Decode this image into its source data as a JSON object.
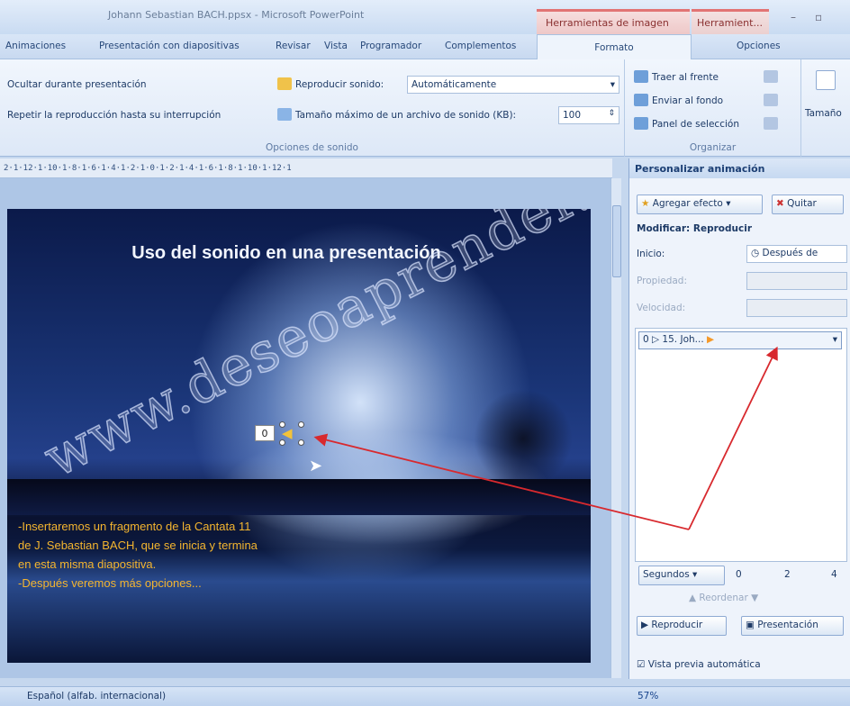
{
  "window": {
    "title": "Johann Sebastian BACH.ppsx - Microsoft PowerPoint",
    "context_tab_image_tools": "Herramientas de imagen",
    "context_tab_other": "Herramient...",
    "minimize": "–",
    "restore": "▫"
  },
  "ribbon_tabs": [
    {
      "label": "Animaciones"
    },
    {
      "label": "Presentación con diapositivas"
    },
    {
      "label": "Revisar"
    },
    {
      "label": "Vista"
    },
    {
      "label": "Programador"
    },
    {
      "label": "Complementos"
    },
    {
      "label": "Formato"
    },
    {
      "label": "Opciones"
    }
  ],
  "sound_options": {
    "hide_during_show": "Ocultar durante presentación",
    "loop_until_stopped": "Repetir la reproducción hasta su interrupción",
    "play_sound_label": "Reproducir sonido:",
    "play_sound_value": "Automáticamente",
    "max_size_label": "Tamaño máximo de un archivo de sonido (KB):",
    "max_size_value": "100",
    "group_label": "Opciones de sonido"
  },
  "arrange": {
    "bring_to_front": "Traer al frente",
    "send_to_back": "Enviar al fondo",
    "selection_pane": "Panel de selección",
    "group_label": "Organizar"
  },
  "size": {
    "label": "Tamaño"
  },
  "ruler": {
    "text": "2·1·12·1·10·1·8·1·6·1·4·1·2·1·0·1·2·1·4·1·6·1·8·1·10·1·12·1"
  },
  "slide": {
    "title": "Uso del sonido  en una presentación",
    "body_lines": [
      "-Insertaremos un fragmento de la Cantata 11",
      "de J. Sebastian BACH, que se inicia y termina",
      "en esta misma diapositiva.",
      "-Después veremos más opciones..."
    ],
    "sound_order": "0",
    "watermark": "www.deseoaprender.com"
  },
  "task_pane": {
    "title": "Personalizar animación",
    "add_effect": "Agregar efecto",
    "remove": "Quitar",
    "modify_label": "Modificar: Reproducir",
    "start_label": "Inicio:",
    "start_value": "Después de",
    "property_label": "Propiedad:",
    "speed_label": "Velocidad:",
    "list_item": "0 ▷  15. Joh...",
    "seconds": "Segundos",
    "timeline_labels": [
      "0",
      "2",
      "4"
    ],
    "reorder": "Reordenar",
    "play": "Reproducir",
    "slideshow": "Presentación",
    "autopreview": "Vista previa automática"
  },
  "statusbar": {
    "language": "Español (alfab. internacional)",
    "zoom": "57%"
  }
}
